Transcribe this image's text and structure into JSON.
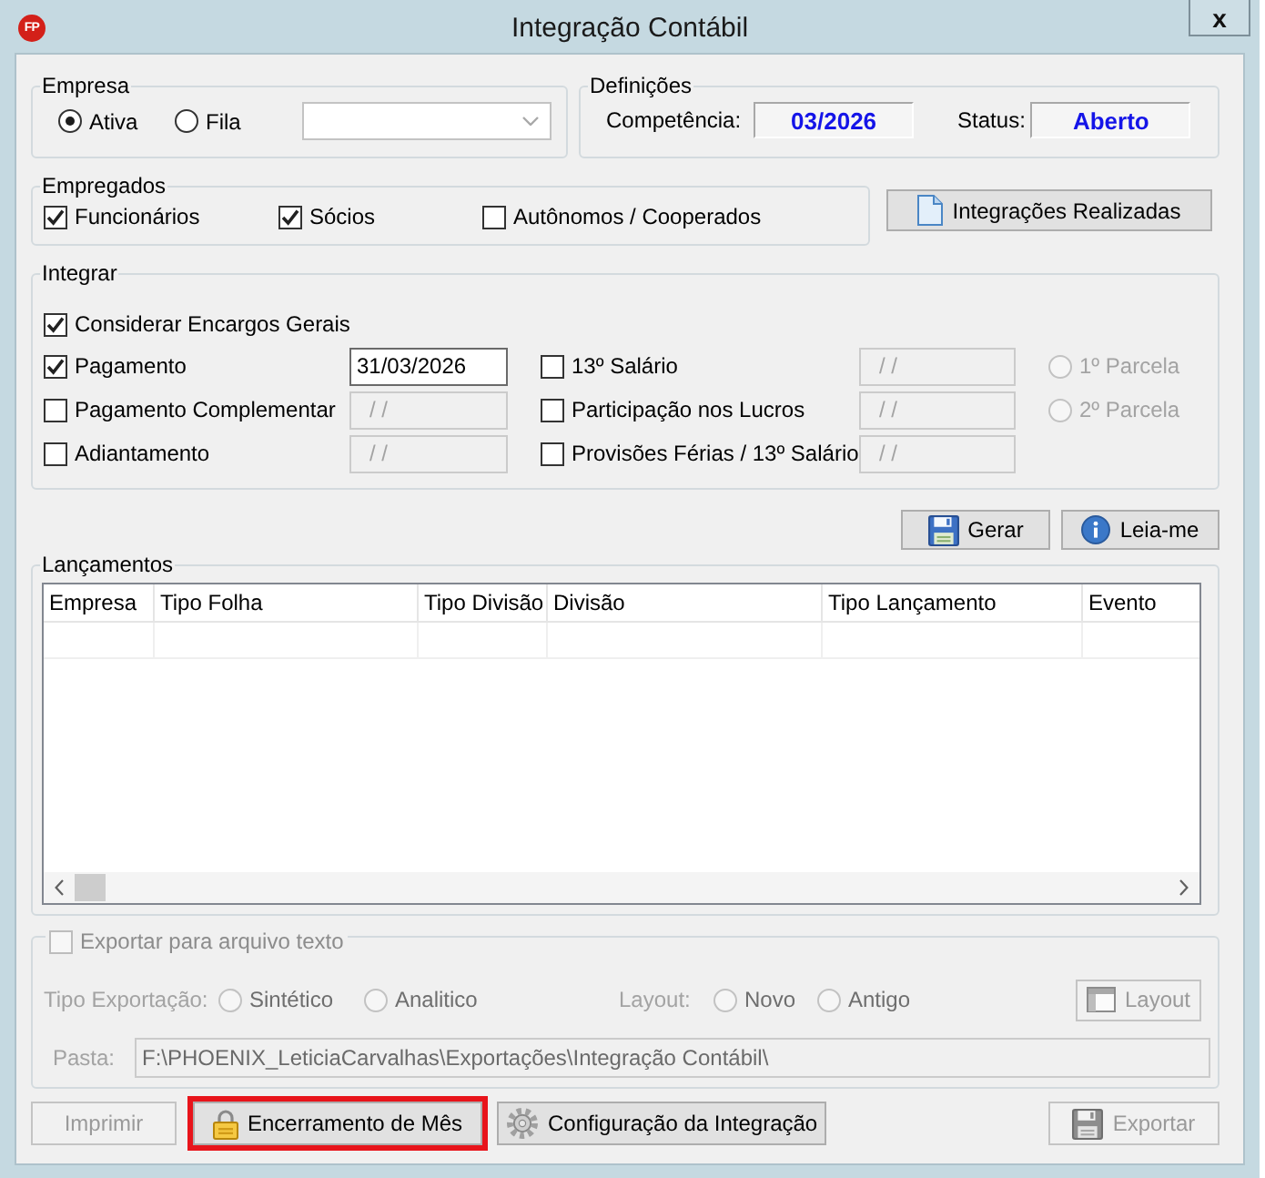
{
  "window": {
    "logo": "FP",
    "title": "Integração Contábil",
    "close": "x"
  },
  "empresa": {
    "title": "Empresa",
    "options": [
      {
        "label": "Ativa",
        "selected": true
      },
      {
        "label": "Fila",
        "selected": false
      }
    ]
  },
  "definicoes": {
    "title": "Definições",
    "fields": [
      {
        "label": "Competência:",
        "value": "03/2026"
      },
      {
        "label": "Status:",
        "value": "Aberto"
      }
    ]
  },
  "empregados": {
    "title": "Empregados",
    "items": [
      {
        "label": "Funcionários",
        "checked": true
      },
      {
        "label": "Sócios",
        "checked": true
      },
      {
        "label": "Autônomos / Cooperados",
        "checked": false
      }
    ]
  },
  "integracoes_button": {
    "label": "Integrações Realizadas"
  },
  "integrar": {
    "title": "Integrar",
    "encargos": {
      "label": "Considerar Encargos Gerais",
      "checked": true
    },
    "rows": [
      {
        "left": {
          "label": "Pagamento",
          "checked": true,
          "date": "31/03/2026",
          "disabled": false
        },
        "right": {
          "label": "13º Salário",
          "checked": false,
          "date": "/ /",
          "disabled": true
        },
        "parcela": {
          "label": "1º Parcela",
          "selected": false,
          "disabled": true
        }
      },
      {
        "left": {
          "label": "Pagamento Complementar",
          "checked": false,
          "date": "/ /",
          "disabled": true
        },
        "right": {
          "label": "Participação nos Lucros",
          "checked": false,
          "date": "/ /",
          "disabled": true
        },
        "parcela": {
          "label": "2º Parcela",
          "selected": false,
          "disabled": true
        }
      },
      {
        "left": {
          "label": "Adiantamento",
          "checked": false,
          "date": "/ /",
          "disabled": true
        },
        "right": {
          "label": "Provisões Férias / 13º Salário",
          "checked": false,
          "date": "/ /",
          "disabled": true
        }
      }
    ]
  },
  "action_buttons": [
    {
      "kind": "generate",
      "label": "Gerar"
    },
    {
      "kind": "readme",
      "label": "Leia-me"
    }
  ],
  "lancamentos": {
    "title": "Lançamentos",
    "columns": [
      "Empresa",
      "Tipo Folha",
      "Tipo Divisão",
      "Divisão",
      "Tipo Lançamento",
      "Evento"
    ]
  },
  "exportar": {
    "disabled": true,
    "toggle": {
      "label": "Exportar para arquivo texto",
      "checked": false
    },
    "tipo": {
      "label": "Tipo Exportação:",
      "options": [
        {
          "label": "Sintético",
          "selected": false
        },
        {
          "label": "Analitico",
          "selected": false
        }
      ]
    },
    "layout": {
      "label": "Layout:",
      "options": [
        {
          "label": "Novo",
          "selected": false
        },
        {
          "label": "Antigo",
          "selected": false
        }
      ]
    },
    "layout_button": {
      "label": "Layout",
      "disabled": true
    },
    "pasta": {
      "label": "Pasta:",
      "value": "F:\\PHOENIX_LeticiaCarvalhas\\Exportações\\Integração Contábil\\"
    }
  },
  "footer_buttons": [
    {
      "kind": "print",
      "label": "Imprimir",
      "disabled": true,
      "highlighted": false
    },
    {
      "kind": "lock",
      "label": "Encerramento de Mês",
      "disabled": false,
      "highlighted": true
    },
    {
      "kind": "gear",
      "label": "Configuração da Integração",
      "disabled": false,
      "highlighted": false
    },
    {
      "kind": "save",
      "label": "Exportar",
      "disabled": true,
      "highlighted": false
    }
  ]
}
